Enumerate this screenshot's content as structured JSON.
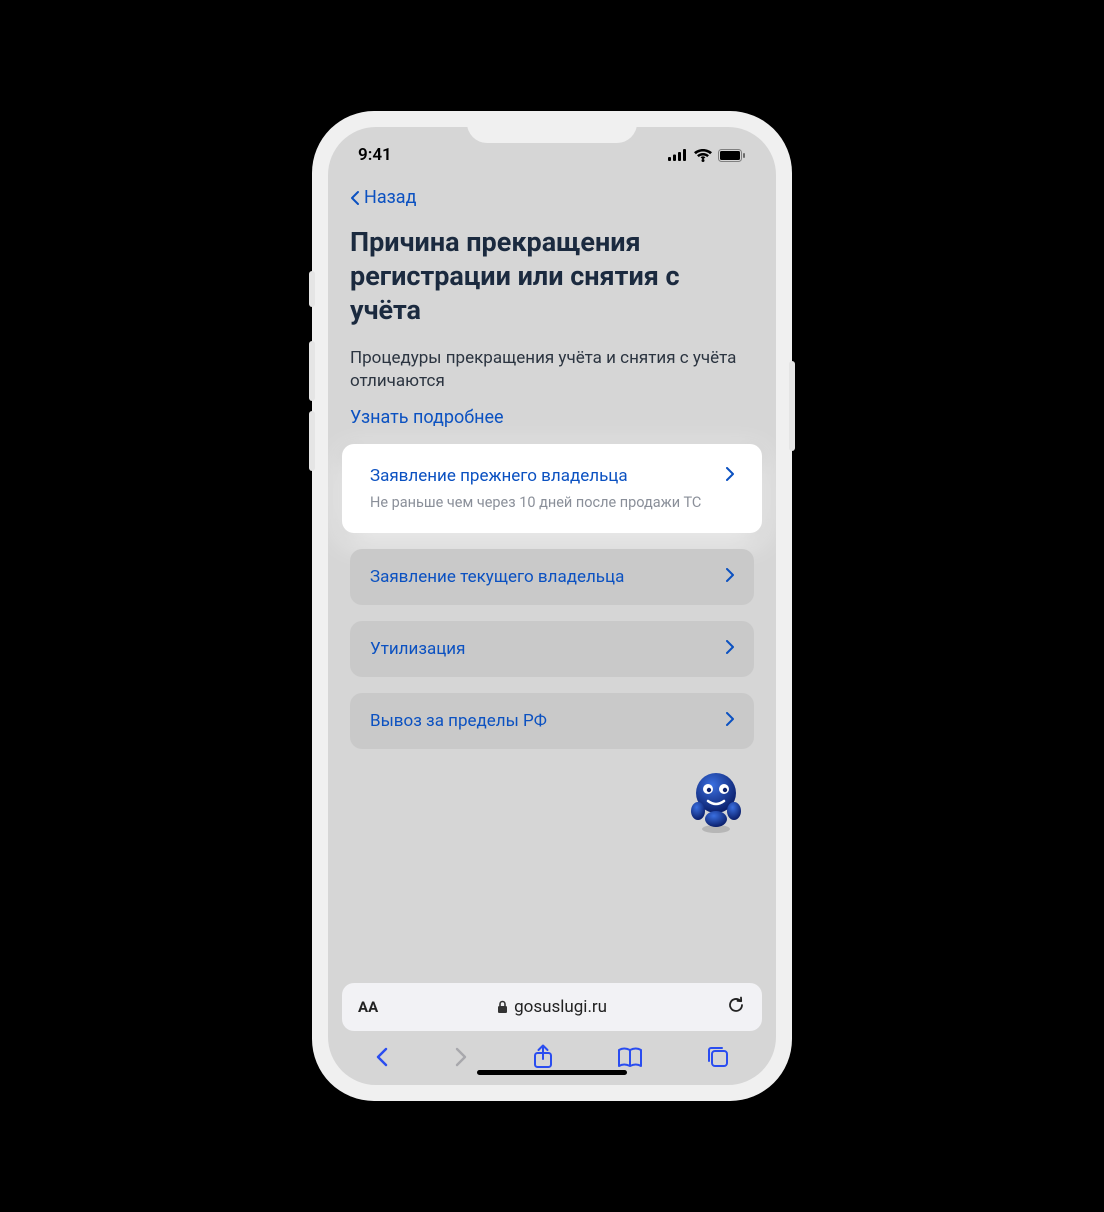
{
  "status": {
    "time": "9:41"
  },
  "nav": {
    "back": "Назад"
  },
  "page": {
    "title": "Причина прекращения регистрации или снятия с учёта",
    "description": "Процедуры прекращения учёта и снятия с учёта отличаются",
    "more": "Узнать подробнее"
  },
  "options": [
    {
      "title": "Заявление прежнего владельца",
      "subtitle": "Не раньше чем через 10 дней после продажи ТС",
      "highlight": true
    },
    {
      "title": "Заявление текущего владельца",
      "subtitle": "",
      "highlight": false
    },
    {
      "title": "Утилизация",
      "subtitle": "",
      "highlight": false
    },
    {
      "title": "Вывоз за пределы РФ",
      "subtitle": "",
      "highlight": false
    }
  ],
  "browser": {
    "domain": "gosuslugi.ru",
    "text_size": "AА"
  }
}
